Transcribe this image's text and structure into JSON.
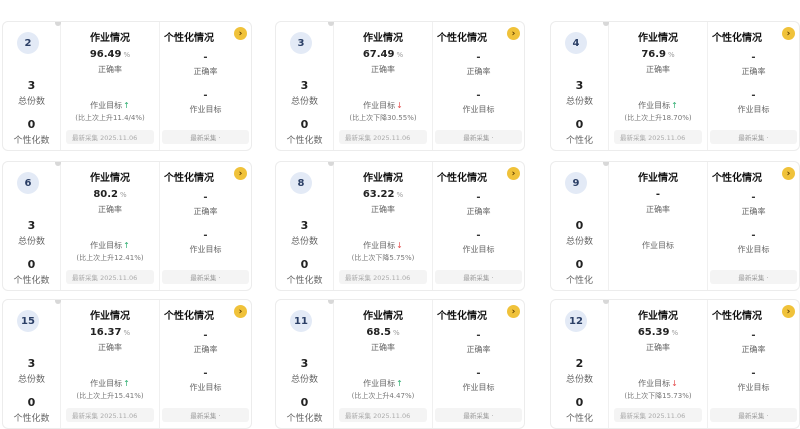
{
  "labels": {
    "work_header": "作业情况",
    "personal_header": "个性化情况",
    "total": "总份数",
    "personalized": "个性化数",
    "personalized_short": "个性化",
    "accuracy": "正确率",
    "goal": "作业目标",
    "unit": "%",
    "dash": "-",
    "latest_collect": "最新采集",
    "latest_collect_btn": "最新采集 ·",
    "arrow_icon": "chevron-right-icon",
    "up_arrow": "↑",
    "down_arrow": "↓"
  },
  "colors": {
    "up": "#2fae71",
    "down": "#e55050",
    "badge": "#f0c23a"
  },
  "cards": [
    {
      "index": "2",
      "total": "3",
      "personalized": "0",
      "personalized_label": "个性化数",
      "rate": "96.49",
      "trend": "up",
      "comparison": "(比上次上升11.4/4%)",
      "collect_date": "最新采集 2025.11.06"
    },
    {
      "index": "3",
      "total": "3",
      "personalized": "0",
      "personalized_label": "个性化数",
      "rate": "67.49",
      "trend": "down",
      "comparison": "(比上次下降30.55%)",
      "collect_date": "最新采集 2025.11.06"
    },
    {
      "index": "4",
      "total": "3",
      "personalized": "0",
      "personalized_label": "个性化",
      "rate": "76.9",
      "trend": "up",
      "comparison": "(比上次上升18.70%)",
      "collect_date": "最新采集 2025.11.06"
    },
    {
      "index": "6",
      "total": "3",
      "personalized": "0",
      "personalized_label": "个性化数",
      "rate": "80.2",
      "trend": "up",
      "comparison": "(比上次上升12.41%)",
      "collect_date": "最新采集 2025.11.06"
    },
    {
      "index": "8",
      "total": "3",
      "personalized": "0",
      "personalized_label": "个性化数",
      "rate": "63.22",
      "trend": "down",
      "comparison": "(比上次下降5.75%)",
      "collect_date": "最新采集 2025.11.06"
    },
    {
      "index": "9",
      "total": "0",
      "personalized": "0",
      "personalized_label": "个性化",
      "rate": "",
      "trend": "none",
      "comparison": "",
      "collect_date": ""
    },
    {
      "index": "15",
      "total": "3",
      "personalized": "0",
      "personalized_label": "个性化数",
      "rate": "16.37",
      "trend": "up",
      "comparison": "(比上次上升15.41%)",
      "collect_date": "最新采集 2025.11.06"
    },
    {
      "index": "11",
      "total": "3",
      "personalized": "0",
      "personalized_label": "个性化数",
      "rate": "68.5",
      "trend": "up",
      "comparison": "(比上次上升4.47%)",
      "collect_date": "最新采集 2025.11.06"
    },
    {
      "index": "12",
      "total": "2",
      "personalized": "0",
      "personalized_label": "个性化",
      "rate": "65.39",
      "trend": "down",
      "comparison": "(比上次下降15.73%)",
      "collect_date": "最新采集 2025.11.06"
    }
  ]
}
